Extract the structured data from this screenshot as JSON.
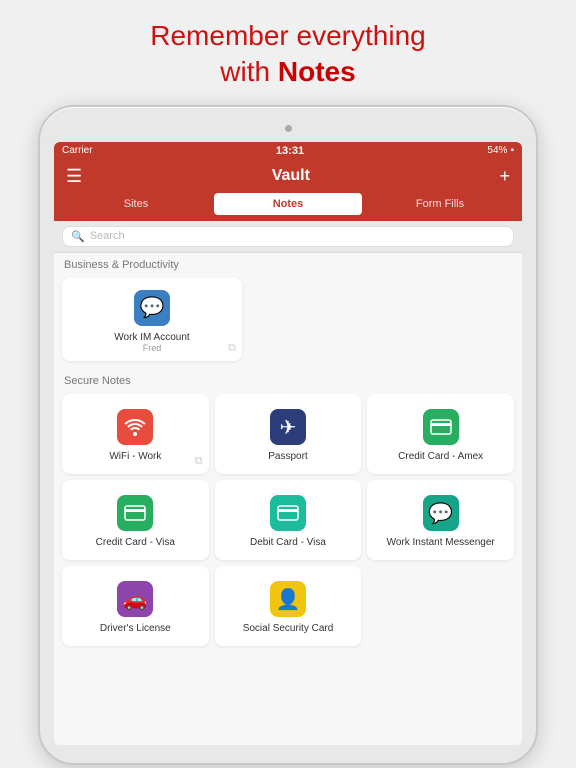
{
  "header": {
    "line1": "Remember everything",
    "line2": "with ",
    "line2bold": "Notes"
  },
  "statusBar": {
    "carrier": "Carrier",
    "wifi": "📶",
    "time": "13:31",
    "battery": "54%"
  },
  "navBar": {
    "menuIcon": "☰",
    "title": "Vault",
    "addIcon": "+"
  },
  "tabs": [
    {
      "label": "Sites",
      "active": false
    },
    {
      "label": "Notes",
      "active": true
    },
    {
      "label": "Form Fills",
      "active": false
    }
  ],
  "search": {
    "placeholder": "Search"
  },
  "sections": [
    {
      "title": "Business & Productivity",
      "items": [
        {
          "label": "Work IM Account",
          "sublabel": "Fred",
          "iconType": "chat",
          "iconColor": "blue",
          "showCopy": true
        }
      ]
    },
    {
      "title": "Secure Notes",
      "items": [
        {
          "label": "WiFi - Work",
          "sublabel": "",
          "iconType": "wifi",
          "iconColor": "red",
          "showCopy": true
        },
        {
          "label": "Passport",
          "sublabel": "",
          "iconType": "plane",
          "iconColor": "dark-blue",
          "showCopy": false
        },
        {
          "label": "Credit Card - Amex",
          "sublabel": "",
          "iconType": "card",
          "iconColor": "green",
          "showCopy": false
        },
        {
          "label": "Credit Card - Visa",
          "sublabel": "",
          "iconType": "card",
          "iconColor": "green",
          "showCopy": false
        },
        {
          "label": "Debit Card - Visa",
          "sublabel": "",
          "iconType": "card",
          "iconColor": "teal",
          "showCopy": false
        },
        {
          "label": "Work Instant Messenger",
          "sublabel": "",
          "iconType": "chat",
          "iconColor": "cyan",
          "showCopy": false
        },
        {
          "label": "Driver's License",
          "sublabel": "",
          "iconType": "car",
          "iconColor": "purple",
          "showCopy": false
        },
        {
          "label": "Social Security Card",
          "sublabel": "",
          "iconType": "person",
          "iconColor": "yellow",
          "showCopy": false
        }
      ]
    }
  ]
}
